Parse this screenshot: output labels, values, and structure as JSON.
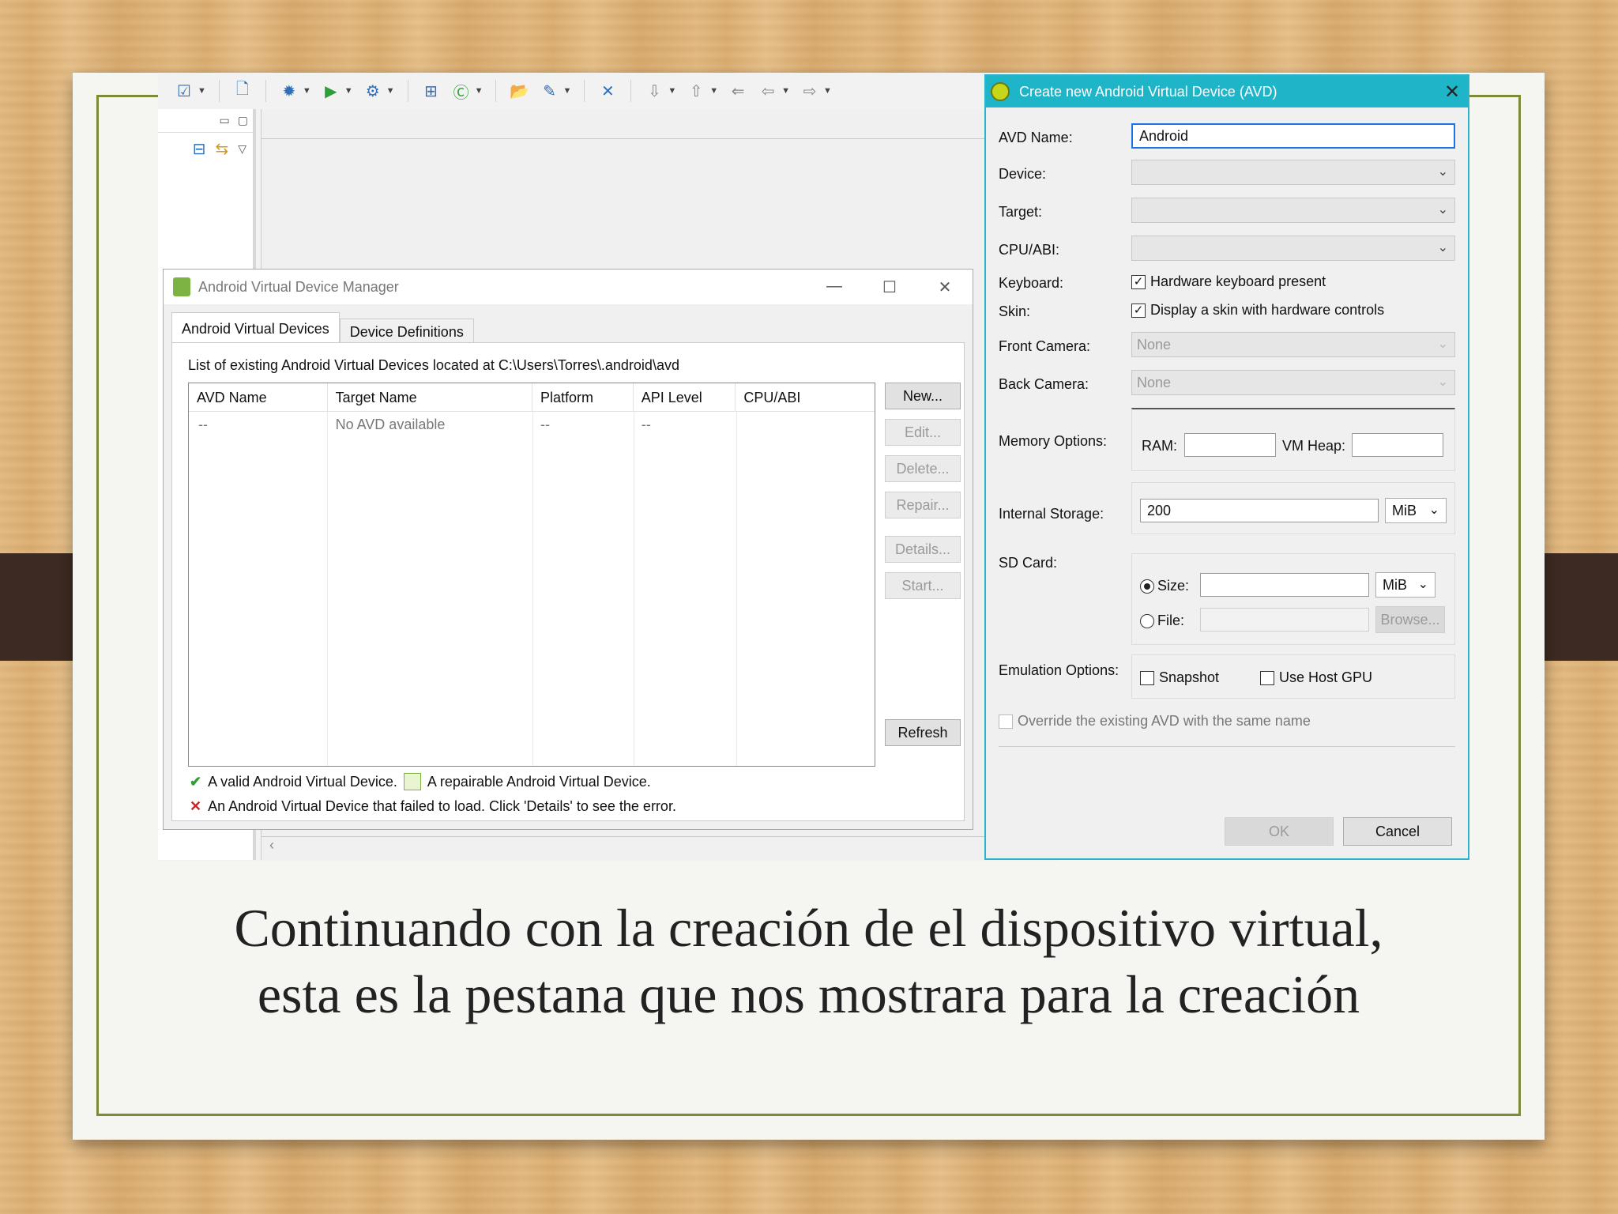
{
  "caption": {
    "line1": "Continuando con la creación de el dispositivo virtual,",
    "line2": "esta es la pestana que nos mostrara para la creación"
  },
  "avd_manager": {
    "title": "Android Virtual Device Manager",
    "tabs": [
      "Android Virtual Devices",
      "Device Definitions"
    ],
    "path_label": "List of existing Android Virtual Devices located at C:\\Users\\Torres\\.android\\avd",
    "columns": [
      "AVD Name",
      "Target Name",
      "Platform",
      "API Level",
      "CPU/ABI"
    ],
    "row": [
      "--",
      "No AVD available",
      "--",
      "--",
      ""
    ],
    "buttons": {
      "new": "New...",
      "edit": "Edit...",
      "delete": "Delete...",
      "repair": "Repair...",
      "details": "Details...",
      "start": "Start...",
      "refresh": "Refresh"
    },
    "legend": {
      "valid": "A valid Android Virtual Device.",
      "repairable": "A repairable Android Virtual Device.",
      "failed": "An Android Virtual Device that failed to load. Click 'Details' to see the error."
    }
  },
  "create_dialog": {
    "title": "Create new Android Virtual Device (AVD)",
    "avd_name_label": "AVD Name:",
    "avd_name_value": "Android",
    "device_label": "Device:",
    "target_label": "Target:",
    "cpu_label": "CPU/ABI:",
    "keyboard_label": "Keyboard:",
    "keyboard_option": "Hardware keyboard present",
    "skin_label": "Skin:",
    "skin_option": "Display a skin with hardware controls",
    "front_camera_label": "Front Camera:",
    "front_camera_value": "None",
    "back_camera_label": "Back Camera:",
    "back_camera_value": "None",
    "memory_label": "Memory Options:",
    "ram_label": "RAM:",
    "vm_heap_label": "VM Heap:",
    "storage_label": "Internal Storage:",
    "storage_value": "200",
    "storage_unit": "MiB",
    "sd_label": "SD Card:",
    "sd_size_label": "Size:",
    "sd_size_unit": "MiB",
    "sd_file_label": "File:",
    "browse": "Browse...",
    "emulation_label": "Emulation Options:",
    "snapshot": "Snapshot",
    "host_gpu": "Use Host GPU",
    "override": "Override the existing AVD with the same name",
    "ok": "OK",
    "cancel": "Cancel"
  },
  "colors": {
    "dialog_title": "#1fb5c9",
    "frame": "#7d8a3a"
  }
}
